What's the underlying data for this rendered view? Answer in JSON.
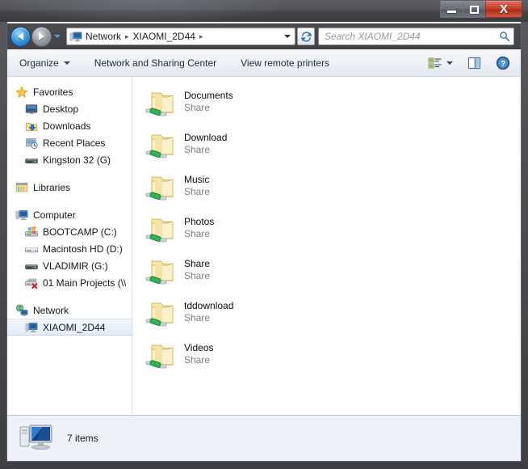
{
  "window": {
    "minimize_label": "Minimize",
    "maximize_label": "Maximize",
    "close_label": "X"
  },
  "addressbar": {
    "back_label": "Back",
    "forward_label": "Forward",
    "recent_label": "Recent pages",
    "crumbs": [
      "Network",
      "XIAOMI_2D44"
    ],
    "separator": "▸",
    "refresh_label": "Refresh"
  },
  "search": {
    "placeholder": "Search XIAOMI_2D44"
  },
  "toolbar": {
    "organize_label": "Organize",
    "network_sharing_label": "Network and Sharing Center",
    "view_printers_label": "View remote printers",
    "views_label": "Change your view",
    "preview_label": "Show the preview pane",
    "help_label": "Get help"
  },
  "sidebar": {
    "groups": [
      {
        "header": {
          "label": "Favorites",
          "icon": "star-icon"
        },
        "items": [
          {
            "label": "Desktop",
            "icon": "desktop-icon"
          },
          {
            "label": "Downloads",
            "icon": "downloads-icon"
          },
          {
            "label": "Recent Places",
            "icon": "recent-places-icon"
          },
          {
            "label": "Kingston 32 (G)",
            "icon": "removable-drive-icon"
          }
        ]
      },
      {
        "header": {
          "label": "Libraries",
          "icon": "libraries-icon"
        },
        "items": []
      },
      {
        "header": {
          "label": "Computer",
          "icon": "computer-icon"
        },
        "items": [
          {
            "label": "BOOTCAMP (C:)",
            "icon": "windows-drive-icon"
          },
          {
            "label": "Macintosh HD (D:)",
            "icon": "hard-drive-icon"
          },
          {
            "label": "VLADIMIR (G:)",
            "icon": "removable-drive-icon"
          },
          {
            "label": "01 Main Projects (\\\\",
            "icon": "disconnected-network-drive-icon"
          }
        ]
      },
      {
        "header": {
          "label": "Network",
          "icon": "network-icon"
        },
        "items": [
          {
            "label": "XIAOMI_2D44",
            "icon": "computer-icon",
            "selected": true
          }
        ]
      }
    ]
  },
  "files": {
    "items": [
      {
        "name": "Documents",
        "type": "Share",
        "icon": "shared-folder-icon"
      },
      {
        "name": "Download",
        "type": "Share",
        "icon": "shared-folder-icon"
      },
      {
        "name": "Music",
        "type": "Share",
        "icon": "shared-folder-icon"
      },
      {
        "name": "Photos",
        "type": "Share",
        "icon": "shared-folder-icon"
      },
      {
        "name": "Share",
        "type": "Share",
        "icon": "shared-folder-icon"
      },
      {
        "name": "tddownload",
        "type": "Share",
        "icon": "shared-folder-icon"
      },
      {
        "name": "Videos",
        "type": "Share",
        "icon": "shared-folder-icon"
      }
    ]
  },
  "statusbar": {
    "item_count": "7 items",
    "icon": "computer-icon"
  },
  "colors": {
    "accent": "#3f9de0",
    "close_button": "#c23d2c",
    "folder": "#f5e2a0",
    "share_pipe": "#1aa34a",
    "selected_row": "#e3ecf6"
  }
}
